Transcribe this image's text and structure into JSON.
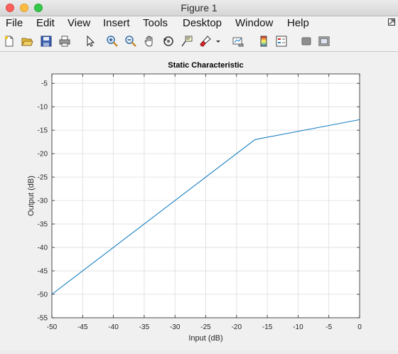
{
  "window": {
    "title": "Figure 1"
  },
  "menu": {
    "items": [
      "File",
      "Edit",
      "View",
      "Insert",
      "Tools",
      "Desktop",
      "Window",
      "Help"
    ]
  },
  "toolbar": {
    "icons": [
      "new-figure-icon",
      "open-file-icon",
      "save-icon",
      "print-icon",
      "edit-plot-arrow-icon",
      "zoom-in-icon",
      "zoom-out-icon",
      "pan-hand-icon",
      "rotate-3d-icon",
      "data-cursor-icon",
      "brush-icon",
      "brush-dropdown-icon",
      "link-plot-icon",
      "colorbar-icon",
      "legend-icon",
      "hide-plot-tools-icon",
      "show-plot-tools-icon"
    ]
  },
  "chart_data": {
    "type": "line",
    "title": "Static Characteristic",
    "xlabel": "Input (dB)",
    "ylabel": "Output (dB)",
    "xlim": [
      -50,
      0
    ],
    "ylim": [
      -55,
      -3
    ],
    "grid": true,
    "xticks": [
      -50,
      -45,
      -40,
      -35,
      -30,
      -25,
      -20,
      -15,
      -10,
      -5,
      0
    ],
    "yticks": [
      -55,
      -50,
      -45,
      -40,
      -35,
      -30,
      -25,
      -20,
      -15,
      -10,
      -5
    ],
    "series": [
      {
        "color": "#0072bd",
        "x": [
          -50,
          -17,
          0
        ],
        "y": [
          -50,
          -17,
          -12.75
        ]
      }
    ]
  }
}
